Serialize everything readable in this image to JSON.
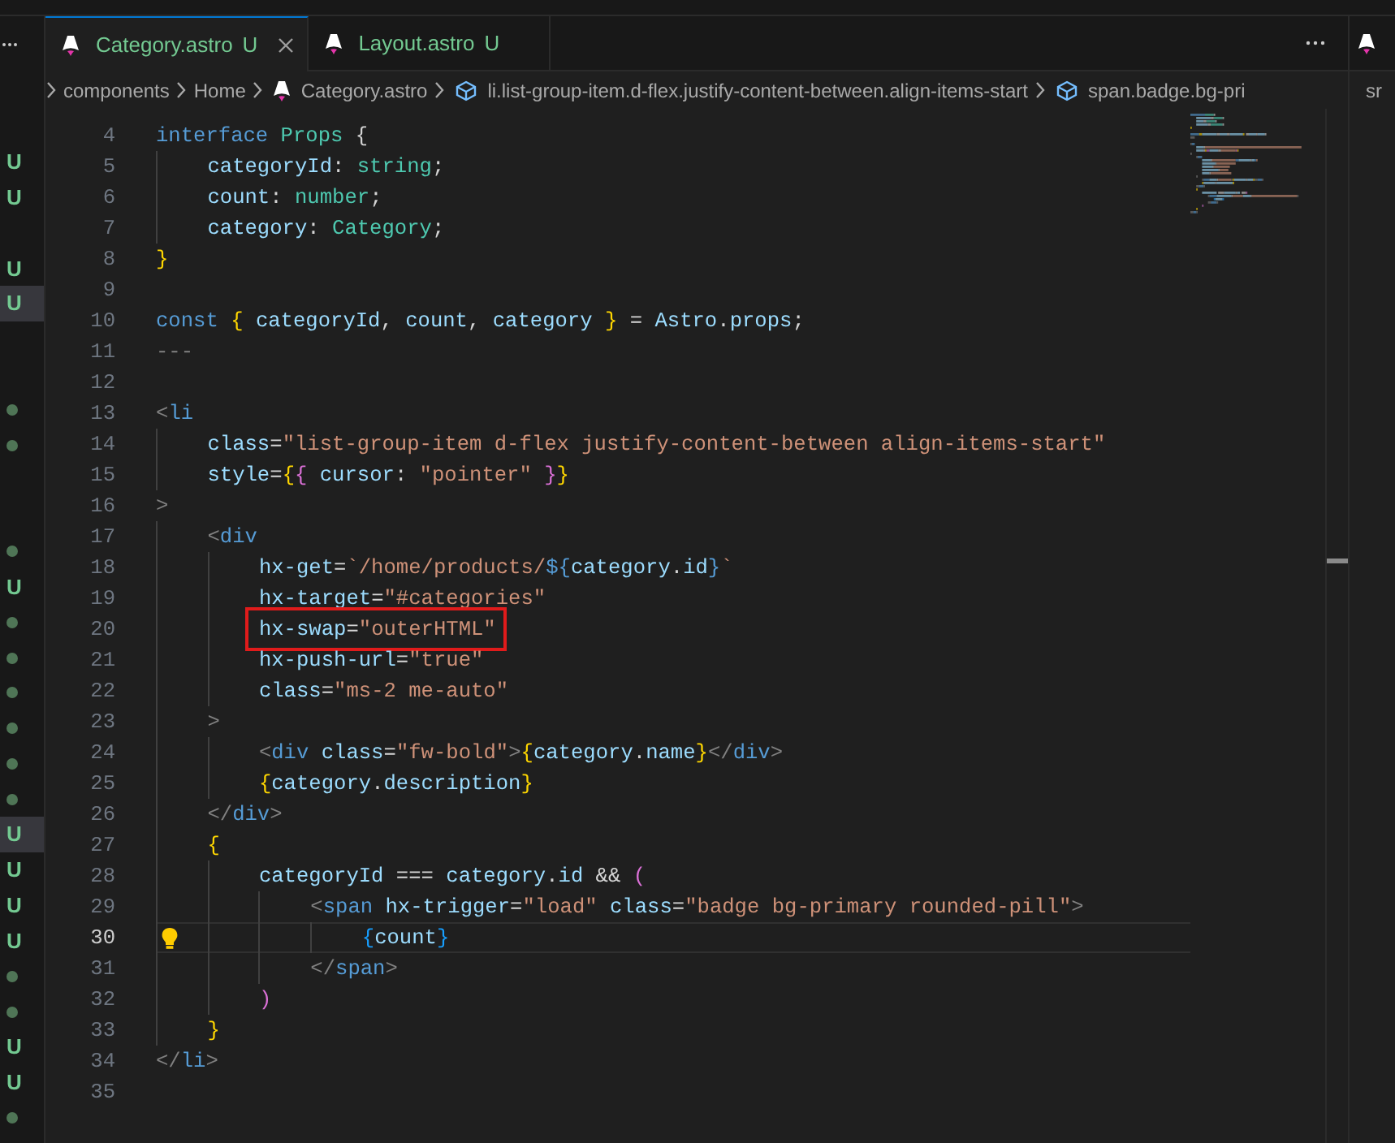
{
  "explorer_badges": [
    {
      "kind": "untracked",
      "text": "U",
      "selected": false
    },
    {
      "kind": "untracked",
      "text": "U",
      "selected": false
    },
    {
      "kind": "empty",
      "selected": false
    },
    {
      "kind": "untracked",
      "text": "U",
      "selected": false
    },
    {
      "kind": "untracked",
      "text": "U",
      "selected": true
    },
    {
      "kind": "empty",
      "selected": false
    },
    {
      "kind": "empty",
      "selected": false
    },
    {
      "kind": "dot",
      "selected": false
    },
    {
      "kind": "dot",
      "selected": false
    },
    {
      "kind": "empty",
      "selected": false
    },
    {
      "kind": "empty",
      "selected": false
    },
    {
      "kind": "dot",
      "selected": false
    },
    {
      "kind": "untracked",
      "text": "U",
      "selected": false
    },
    {
      "kind": "dot",
      "selected": false
    },
    {
      "kind": "dot",
      "selected": false
    },
    {
      "kind": "dot",
      "selected": false
    },
    {
      "kind": "dot",
      "selected": false
    },
    {
      "kind": "dot",
      "selected": false
    },
    {
      "kind": "dot",
      "selected": false
    },
    {
      "kind": "untracked",
      "text": "U",
      "selected": true
    },
    {
      "kind": "untracked",
      "text": "U",
      "selected": false
    },
    {
      "kind": "untracked",
      "text": "U",
      "selected": false
    },
    {
      "kind": "untracked",
      "text": "U",
      "selected": false
    },
    {
      "kind": "dot",
      "selected": false
    },
    {
      "kind": "dot",
      "selected": false
    },
    {
      "kind": "untracked",
      "text": "U",
      "selected": false
    },
    {
      "kind": "untracked",
      "text": "U",
      "selected": false
    },
    {
      "kind": "dot",
      "selected": false
    }
  ],
  "tabs": [
    {
      "label": "Category.astro",
      "status": "U",
      "selected": true
    },
    {
      "label": "Layout.astro",
      "status": "U",
      "selected": false
    }
  ],
  "breadcrumbs": [
    {
      "kind": "folder",
      "label": "components"
    },
    {
      "kind": "folder",
      "label": "Home"
    },
    {
      "kind": "file",
      "label": "Category.astro"
    },
    {
      "kind": "symbol",
      "label": "li.list-group-item.d-flex.justify-content-between.align-items-start"
    },
    {
      "kind": "symbol",
      "label": "span.badge.bg-pri"
    }
  ],
  "side_group": {
    "breadcrumb": "sr"
  },
  "lines": [
    {
      "number": "4",
      "current": false,
      "boxed": false,
      "tokens": [
        {
          "text": "interface ",
          "kind": "kw"
        },
        {
          "text": "Props ",
          "kind": "type"
        },
        {
          "text": "{",
          "kind": "punc"
        }
      ]
    },
    {
      "number": "5",
      "current": false,
      "boxed": false,
      "tokens": [
        {
          "text": "    categoryId",
          "kind": "var"
        },
        {
          "text": ": ",
          "kind": "punc"
        },
        {
          "text": "string",
          "kind": "type"
        },
        {
          "text": ";",
          "kind": "punc"
        }
      ]
    },
    {
      "number": "6",
      "current": false,
      "boxed": false,
      "tokens": [
        {
          "text": "    count",
          "kind": "var"
        },
        {
          "text": ": ",
          "kind": "punc"
        },
        {
          "text": "number",
          "kind": "type"
        },
        {
          "text": ";",
          "kind": "punc"
        }
      ]
    },
    {
      "number": "7",
      "current": false,
      "boxed": false,
      "tokens": [
        {
          "text": "    category",
          "kind": "var"
        },
        {
          "text": ": ",
          "kind": "punc"
        },
        {
          "text": "Category",
          "kind": "type"
        },
        {
          "text": ";",
          "kind": "punc"
        }
      ]
    },
    {
      "number": "8",
      "current": false,
      "boxed": false,
      "tokens": [
        {
          "text": "}",
          "kind": "b1"
        }
      ]
    },
    {
      "number": "9",
      "current": false,
      "boxed": false
    },
    {
      "number": "10",
      "current": false,
      "boxed": false,
      "tokens": [
        {
          "text": "const ",
          "kind": "kw"
        },
        {
          "text": "{ ",
          "kind": "b1"
        },
        {
          "text": "categoryId",
          "kind": "var"
        },
        {
          "text": ", ",
          "kind": "punc"
        },
        {
          "text": "count",
          "kind": "var"
        },
        {
          "text": ", ",
          "kind": "punc"
        },
        {
          "text": "category ",
          "kind": "var"
        },
        {
          "text": "}",
          "kind": "b1"
        },
        {
          "text": " = ",
          "kind": "punc"
        },
        {
          "text": "Astro",
          "kind": "var"
        },
        {
          "text": ".",
          "kind": "punc"
        },
        {
          "text": "props",
          "kind": "var"
        },
        {
          "text": ";",
          "kind": "punc"
        }
      ]
    },
    {
      "number": "11",
      "current": false,
      "boxed": false,
      "tokens": [
        {
          "text": "---",
          "kind": "tag"
        }
      ]
    },
    {
      "number": "12",
      "current": false,
      "boxed": false
    },
    {
      "number": "13",
      "current": false,
      "boxed": false,
      "tokens": [
        {
          "text": "<",
          "kind": "tag"
        },
        {
          "text": "li",
          "kind": "kw"
        }
      ]
    },
    {
      "number": "14",
      "current": false,
      "boxed": false,
      "tokens": [
        {
          "text": "    class",
          "kind": "var"
        },
        {
          "text": "=",
          "kind": "punc"
        },
        {
          "text": "\"list-group-item d-flex justify-content-between align-items-start\"",
          "kind": "str"
        }
      ]
    },
    {
      "number": "15",
      "current": false,
      "boxed": false,
      "tokens": [
        {
          "text": "    style",
          "kind": "var"
        },
        {
          "text": "=",
          "kind": "punc"
        },
        {
          "text": "{",
          "kind": "b1"
        },
        {
          "text": "{ ",
          "kind": "b2"
        },
        {
          "text": "cursor",
          "kind": "var"
        },
        {
          "text": ": ",
          "kind": "punc"
        },
        {
          "text": "\"pointer\" ",
          "kind": "str"
        },
        {
          "text": "}",
          "kind": "b2"
        },
        {
          "text": "}",
          "kind": "b1"
        }
      ]
    },
    {
      "number": "16",
      "current": false,
      "boxed": false,
      "tokens": [
        {
          "text": ">",
          "kind": "tag"
        }
      ]
    },
    {
      "number": "17",
      "current": false,
      "boxed": false,
      "tokens": [
        {
          "text": "    <",
          "kind": "tag"
        },
        {
          "text": "div",
          "kind": "kw"
        }
      ]
    },
    {
      "number": "18",
      "current": false,
      "boxed": false,
      "tokens": [
        {
          "text": "        hx-get",
          "kind": "var"
        },
        {
          "text": "=",
          "kind": "punc"
        },
        {
          "text": "`/home/products/",
          "kind": "str"
        },
        {
          "text": "${",
          "kind": "kw"
        },
        {
          "text": "category",
          "kind": "var"
        },
        {
          "text": ".",
          "kind": "punc"
        },
        {
          "text": "id",
          "kind": "var"
        },
        {
          "text": "}",
          "kind": "kw"
        },
        {
          "text": "`",
          "kind": "str"
        }
      ]
    },
    {
      "number": "19",
      "current": false,
      "boxed": false,
      "tokens": [
        {
          "text": "        hx-target",
          "kind": "var"
        },
        {
          "text": "=",
          "kind": "punc"
        },
        {
          "text": "\"#categories\"",
          "kind": "str"
        }
      ]
    },
    {
      "number": "20",
      "current": false,
      "boxed": true,
      "tokens": [
        {
          "text": "        hx-swap",
          "kind": "var"
        },
        {
          "text": "=",
          "kind": "punc"
        },
        {
          "text": "\"outerHTML\"",
          "kind": "str"
        }
      ]
    },
    {
      "number": "21",
      "current": false,
      "boxed": false,
      "tokens": [
        {
          "text": "        hx-push-url",
          "kind": "var"
        },
        {
          "text": "=",
          "kind": "punc"
        },
        {
          "text": "\"true\"",
          "kind": "str"
        }
      ]
    },
    {
      "number": "22",
      "current": false,
      "boxed": false,
      "tokens": [
        {
          "text": "        class",
          "kind": "var"
        },
        {
          "text": "=",
          "kind": "punc"
        },
        {
          "text": "\"ms-2 me-auto\"",
          "kind": "str"
        }
      ]
    },
    {
      "number": "23",
      "current": false,
      "boxed": false,
      "tokens": [
        {
          "text": "    >",
          "kind": "tag"
        }
      ]
    },
    {
      "number": "24",
      "current": false,
      "boxed": false,
      "tokens": [
        {
          "text": "        <",
          "kind": "tag"
        },
        {
          "text": "div ",
          "kind": "kw"
        },
        {
          "text": "class",
          "kind": "var"
        },
        {
          "text": "=",
          "kind": "punc"
        },
        {
          "text": "\"fw-bold\"",
          "kind": "str"
        },
        {
          "text": ">",
          "kind": "tag"
        },
        {
          "text": "{",
          "kind": "b1"
        },
        {
          "text": "category",
          "kind": "var"
        },
        {
          "text": ".",
          "kind": "punc"
        },
        {
          "text": "name",
          "kind": "var"
        },
        {
          "text": "}",
          "kind": "b1"
        },
        {
          "text": "</",
          "kind": "tag"
        },
        {
          "text": "div",
          "kind": "kw"
        },
        {
          "text": ">",
          "kind": "tag"
        }
      ]
    },
    {
      "number": "25",
      "current": false,
      "boxed": false,
      "tokens": [
        {
          "text": "        {",
          "kind": "b1"
        },
        {
          "text": "category",
          "kind": "var"
        },
        {
          "text": ".",
          "kind": "punc"
        },
        {
          "text": "description",
          "kind": "var"
        },
        {
          "text": "}",
          "kind": "b1"
        }
      ]
    },
    {
      "number": "26",
      "current": false,
      "boxed": false,
      "tokens": [
        {
          "text": "    </",
          "kind": "tag"
        },
        {
          "text": "div",
          "kind": "kw"
        },
        {
          "text": ">",
          "kind": "tag"
        }
      ]
    },
    {
      "number": "27",
      "current": false,
      "boxed": false,
      "tokens": [
        {
          "text": "    {",
          "kind": "b1"
        }
      ]
    },
    {
      "number": "28",
      "current": false,
      "boxed": false,
      "tokens": [
        {
          "text": "        categoryId",
          "kind": "var"
        },
        {
          "text": " === ",
          "kind": "punc"
        },
        {
          "text": "category",
          "kind": "var"
        },
        {
          "text": ".",
          "kind": "punc"
        },
        {
          "text": "id",
          "kind": "var"
        },
        {
          "text": " && ",
          "kind": "punc"
        },
        {
          "text": "(",
          "kind": "b2"
        }
      ]
    },
    {
      "number": "29",
      "current": false,
      "boxed": false,
      "tokens": [
        {
          "text": "            <",
          "kind": "tag"
        },
        {
          "text": "span ",
          "kind": "kw"
        },
        {
          "text": "hx-trigger",
          "kind": "var"
        },
        {
          "text": "=",
          "kind": "punc"
        },
        {
          "text": "\"load\" ",
          "kind": "str"
        },
        {
          "text": "class",
          "kind": "var"
        },
        {
          "text": "=",
          "kind": "punc"
        },
        {
          "text": "\"badge bg-primary rounded-pill\"",
          "kind": "str"
        },
        {
          "text": ">",
          "kind": "tag"
        }
      ]
    },
    {
      "number": "30",
      "current": true,
      "boxed": false,
      "tokens": [
        {
          "text": "                {",
          "kind": "b3"
        },
        {
          "text": "count",
          "kind": "var"
        },
        {
          "text": "}",
          "kind": "b3"
        }
      ]
    },
    {
      "number": "31",
      "current": false,
      "boxed": false,
      "tokens": [
        {
          "text": "            </",
          "kind": "tag"
        },
        {
          "text": "span",
          "kind": "kw"
        },
        {
          "text": ">",
          "kind": "tag"
        }
      ]
    },
    {
      "number": "32",
      "current": false,
      "boxed": false,
      "tokens": [
        {
          "text": "        )",
          "kind": "b2"
        }
      ]
    },
    {
      "number": "33",
      "current": false,
      "boxed": false,
      "tokens": [
        {
          "text": "    }",
          "kind": "b1"
        }
      ]
    },
    {
      "number": "34",
      "current": false,
      "boxed": false,
      "tokens": [
        {
          "text": "</",
          "kind": "tag"
        },
        {
          "text": "li",
          "kind": "kw"
        },
        {
          "text": ">",
          "kind": "tag"
        }
      ]
    },
    {
      "number": "35",
      "current": false,
      "boxed": false
    }
  ]
}
